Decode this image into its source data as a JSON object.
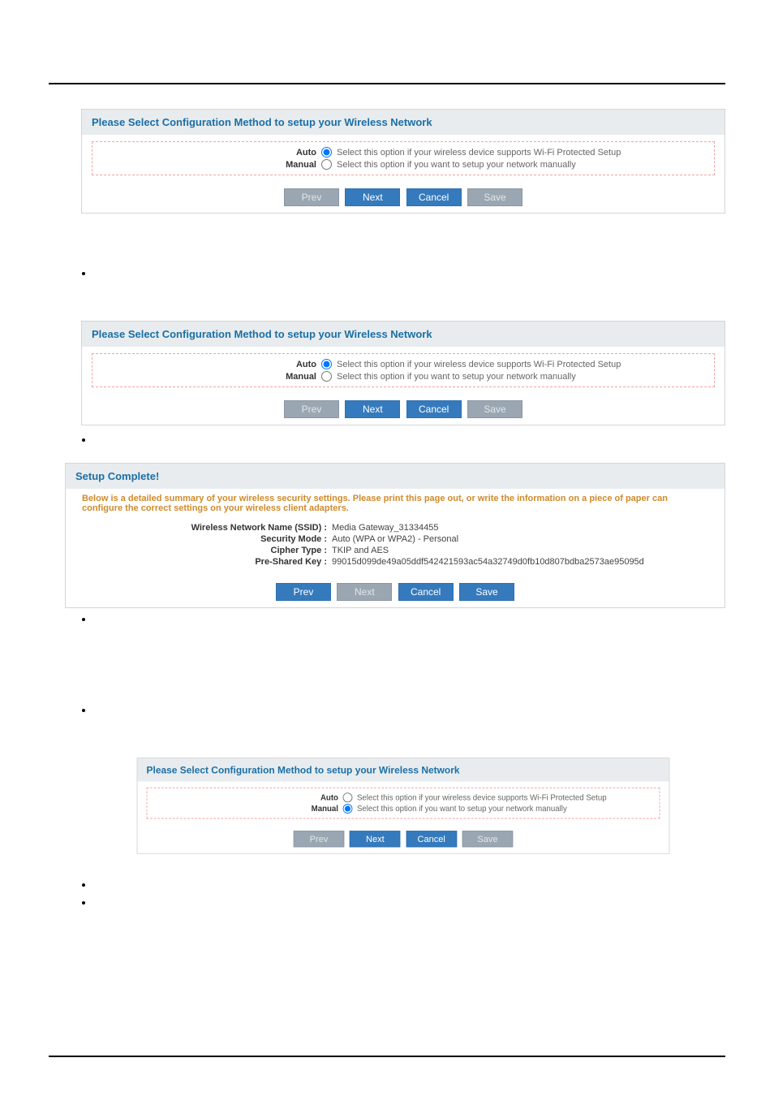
{
  "panels": {
    "p1": {
      "title": "Please Select Configuration Method to setup your Wireless Network",
      "auto_label": "Auto",
      "manual_label": "Manual",
      "auto_desc": "Select this option if your wireless device supports Wi-Fi Protected Setup",
      "manual_desc": "Select this option if you want to setup your network manually"
    },
    "p2": {
      "title": "Please Select Configuration Method to setup your Wireless Network",
      "auto_label": "Auto",
      "manual_label": "Manual",
      "auto_desc": "Select this option if your wireless device supports Wi-Fi Protected Setup",
      "manual_desc": "Select this option if you want to setup your network manually"
    },
    "p3": {
      "title": "Setup Complete!",
      "summary": "Below is a detailed summary of your wireless security settings. Please print this page out, or write the information on a piece of paper can configure the correct settings on your wireless client adapters.",
      "ssid_label": "Wireless Network Name (SSID) :",
      "ssid_value": "Media Gateway_31334455",
      "secmode_label": "Security Mode :",
      "secmode_value": "Auto (WPA or WPA2) - Personal",
      "cipher_label": "Cipher Type :",
      "cipher_value": "TKIP and AES",
      "psk_label": "Pre-Shared Key :",
      "psk_value": "99015d099de49a05ddf542421593ac54a32749d0fb10d807bdba2573ae95095d"
    },
    "p4": {
      "title": "Please Select Configuration Method to setup your Wireless Network",
      "auto_label": "Auto",
      "manual_label": "Manual",
      "auto_desc": "Select this option if your wireless device supports Wi-Fi Protected Setup",
      "manual_desc": "Select this option if you want to setup your network manually"
    }
  },
  "buttons": {
    "prev": "Prev",
    "next": "Next",
    "cancel": "Cancel",
    "save": "Save"
  },
  "steps": {
    "s1": "",
    "s2": "",
    "s3": "",
    "s4": "",
    "s5": "",
    "s6": ""
  }
}
